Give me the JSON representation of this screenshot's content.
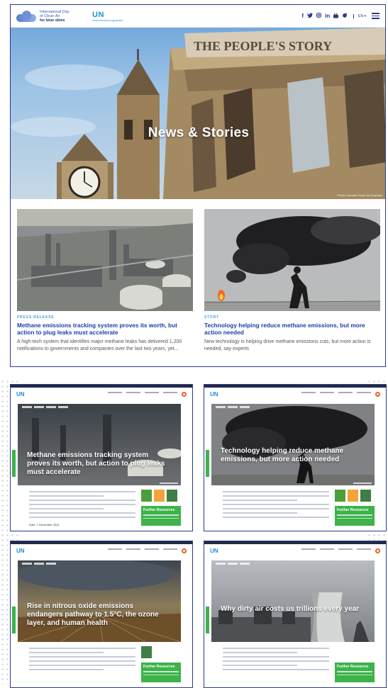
{
  "header": {
    "logo_line1": "International Day",
    "logo_line2": "of Clean Air",
    "logo_line3": "for blue skies",
    "un_logo": "UN",
    "un_subtitle": "environment programme",
    "social_icons": [
      "facebook-icon",
      "twitter-icon",
      "instagram-icon",
      "linkedin-icon",
      "youtube-icon",
      "flickr-icon"
    ],
    "language": "EN"
  },
  "hero": {
    "title": "News & Stories",
    "sign_text": "THE PEOPLE'S STORY",
    "credit": "Photo: Camellia Frank via Unsplash"
  },
  "cards": [
    {
      "tag": "PRESS RELEASE",
      "title": "Methane emissions tracking system proves its worth, but action to plug leaks must accelerate",
      "description": "A high-tech system that identifies major methane leaks has delivered 1,200 notifications to governments and companies over the last two years, yet..."
    },
    {
      "tag": "STORY",
      "title": "Technology helping reduce methane emissions, but more action needed",
      "description": "New technology is helping drive methane emissions cuts, but more action is needed, say experts"
    }
  ],
  "mini_pages": [
    {
      "title": "Methane emissions tracking system proves its worth, but action to plug leaks must accelerate",
      "date": "Date: 7 December 2024"
    },
    {
      "title": "Technology helping reduce methane emissions, but more action needed"
    },
    {
      "title": "Rise in nitrous oxide emissions endangers pathway to 1.5°C, the ozone layer, and human health"
    },
    {
      "title": "Why dirty air costs us trillions every year"
    }
  ],
  "further_resources": "Further Resources",
  "mini_un": "UN",
  "colors": {
    "brand_blue": "#2a3a8c",
    "link_blue": "#1e3ea8",
    "tag_blue": "#3aa0d8",
    "green": "#3db34a",
    "orange": "#e8612c"
  }
}
